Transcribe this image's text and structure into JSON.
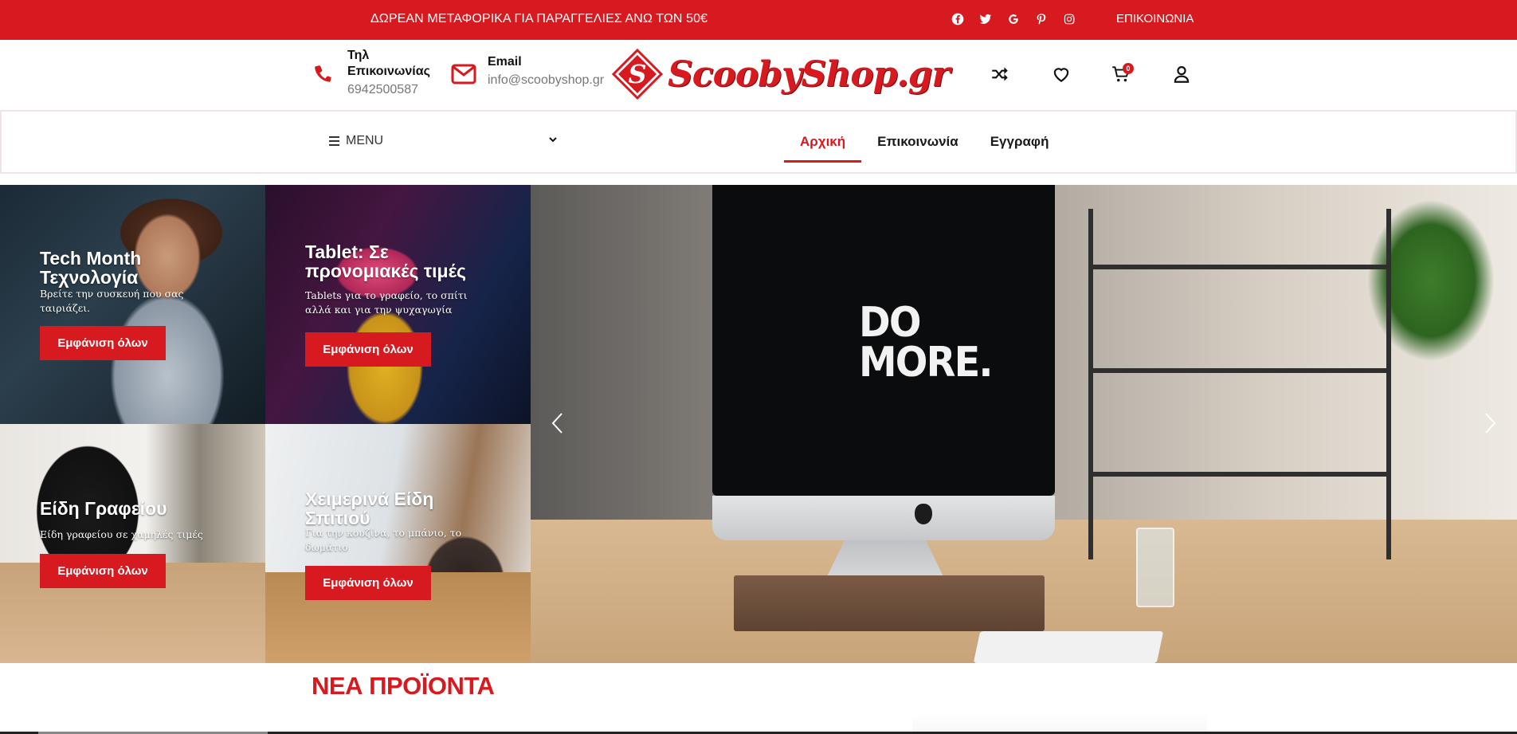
{
  "topbar": {
    "promo": "ΔΩΡΕΑΝ ΜΕΤΑΦΟΡΙΚΑ ΓΙΑ ΠΑΡΑΓΓΕΛΙΕΣ ΑΝΩ ΤΩΝ 50€",
    "socials": [
      "facebook-icon",
      "twitter-icon",
      "google-icon",
      "pinterest-icon",
      "instagram-icon"
    ],
    "contact_link": "ΕΠΙΚΟΙΝΩΝΙΑ"
  },
  "header": {
    "phone": {
      "label": "Τηλ Επικοινωνίας",
      "value": "6942500587"
    },
    "email": {
      "label": "Email",
      "value": "info@scoobyshop.gr"
    },
    "logo_text": "ScoobyShop.gr",
    "icons": [
      "shuffle-compare-icon",
      "heart-icon",
      "cart-icon",
      "user-icon"
    ],
    "cart_count": "0"
  },
  "nav": {
    "menu_label": "MENU",
    "links": [
      {
        "label": "Αρχική",
        "active": true
      },
      {
        "label": "Επικοινωνία",
        "active": false
      },
      {
        "label": "Εγγραφή",
        "active": false
      }
    ]
  },
  "tiles": [
    {
      "title": "Tech Month Τεχνολογία",
      "subtitle": "Βρείτε την συσκευή που σας ταιριάζει.",
      "button": "Εμφάνιση όλων"
    },
    {
      "title": "Tablet: Σε προνομιακές τιμές",
      "subtitle": "Tablets για το γραφείο, το σπίτι αλλά και για την ψυχαγωγία",
      "button": "Εμφάνιση όλων"
    },
    {
      "title": "Είδη Γραφείου",
      "subtitle": "Είδη γραφείου σε χαμηλές τιμές",
      "button": "Εμφάνιση όλων"
    },
    {
      "title": "Χειμερινά Είδη Σπιτιού",
      "subtitle": "Για την κουζίνα, το μπάνιο, το δωμάτιο",
      "button": "Εμφάνιση όλων"
    }
  ],
  "hero": {
    "screen_text_line1": "DO",
    "screen_text_line2": "MORE.",
    "arrows": [
      "arrow-left-icon",
      "arrow-right-icon"
    ]
  },
  "section": {
    "title": "ΝΕΑ ΠΡΟΪΟΝΤΑ"
  },
  "colors": {
    "brand_red": "#d71920",
    "text_dark": "#111111",
    "text_muted": "#777777"
  }
}
